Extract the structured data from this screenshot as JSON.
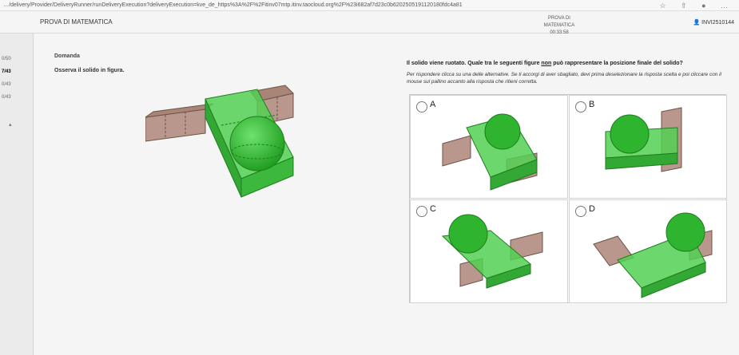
{
  "browser": {
    "url": "…/delivery/Provider/DeliveryRunner/runDeliveryExecution?deliveryExecution=kve_de_https%3A%2F%2Fitinv07mtp.itinv.taocloud.org%2F%23i682af7d23c0b6202505191120180fdc4a81"
  },
  "header": {
    "test_title": "PROVA DI MATEMATICA",
    "center_title": "PROVA DI MATEMATICA",
    "timer": "00:33:58",
    "user_id": "INVI2510144"
  },
  "sidebar": {
    "items": [
      "0/50",
      "7/43",
      "0/43",
      "0/43"
    ]
  },
  "question": {
    "section": "Domanda",
    "stimulus": "Osserva il solido in figura.",
    "prompt_before": "Il solido viene ruotato. Quale tra le seguenti figure ",
    "prompt_underlined": "non",
    "prompt_after": " può rappresentare la posizione finale del solido?",
    "instructions": "Per rispondere clicca su una delle alternative. Se ti accorgi di aver sbagliato, devi prima deselezionare la risposta scelta e poi cliccare con il mouse sul pallino accanto alla risposta che ritieni corretta."
  },
  "choices": [
    {
      "letter": "A"
    },
    {
      "letter": "B"
    },
    {
      "letter": "C"
    },
    {
      "letter": "D"
    }
  ],
  "colors": {
    "green": "#3cc43c",
    "green_dark": "#1e8e1e",
    "brown": "#b08b80",
    "brown_dark": "#6e5248"
  }
}
